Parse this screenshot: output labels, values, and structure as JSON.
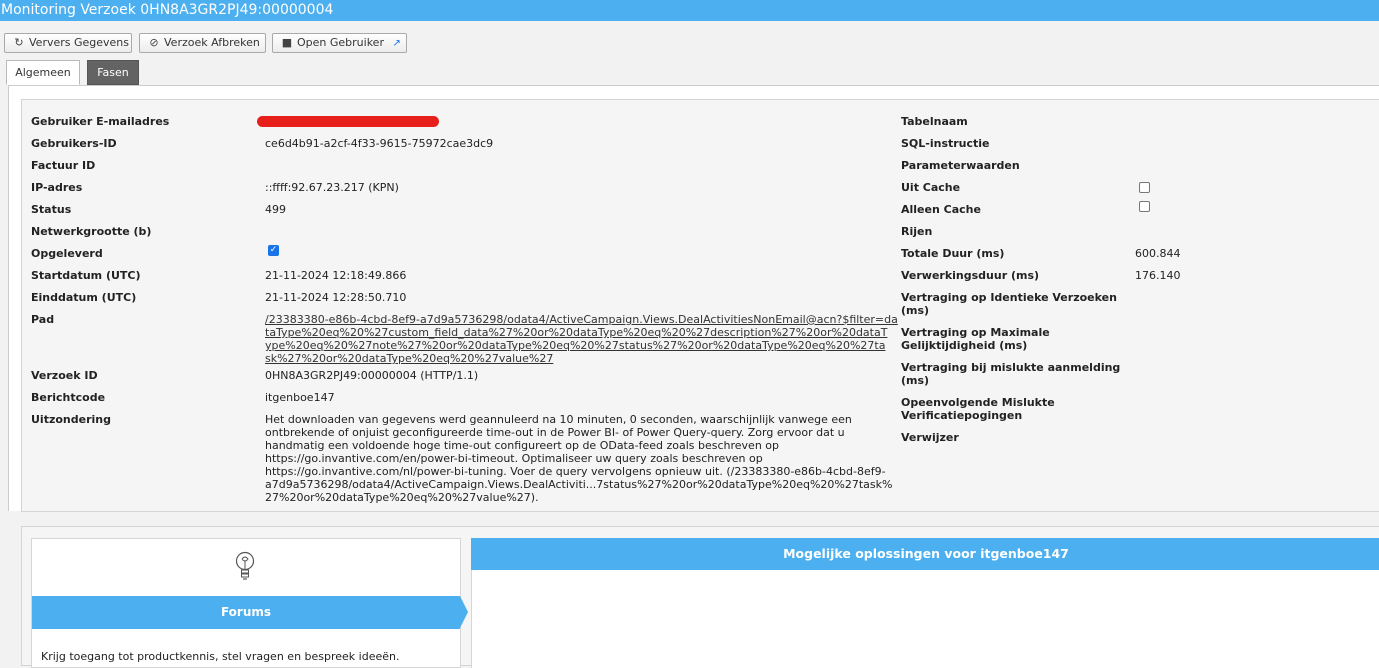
{
  "window": {
    "title": "Monitoring Verzoek 0HN8A3GR2PJ49:00000004"
  },
  "toolbar": {
    "refresh_label": "Ververs Gegevens",
    "abort_label": "Verzoek Afbreken",
    "open_user_label": "Open Gebruiker",
    "refresh_icon": "refresh-icon",
    "abort_icon": "ban-icon",
    "user_icon": "user-icon",
    "external_icon": "external-link-icon"
  },
  "tabs": [
    {
      "label": "Algemeen",
      "active": true
    },
    {
      "label": "Fasen",
      "active": false
    }
  ],
  "left": {
    "email": {
      "label": "Gebruiker E-mailadres",
      "value": ""
    },
    "user_id": {
      "label": "Gebruikers-ID",
      "value": "ce6d4b91-a2cf-4f33-9615-75972cae3dc9"
    },
    "invoice_id": {
      "label": "Factuur ID",
      "value": ""
    },
    "ip": {
      "label": "IP-adres",
      "value": "::ffff:92.67.23.217 (KPN)"
    },
    "status": {
      "label": "Status",
      "value": "499"
    },
    "network_size": {
      "label": "Netwerkgrootte (b)",
      "value": ""
    },
    "delivered": {
      "label": "Opgeleverd",
      "checked": true
    },
    "start": {
      "label": "Startdatum (UTC)",
      "value": "21-11-2024 12:18:49.866"
    },
    "end": {
      "label": "Einddatum (UTC)",
      "value": "21-11-2024 12:28:50.710"
    },
    "path": {
      "label": "Pad",
      "lines": [
        "/23383380-e86b-4cbd-8ef9-a7d9a5736298/odata4/ActiveCampaign.Views.DealActivitiesNonEmail@acn?$filter=da",
        "taType%20eq%20%27custom_field_data%27%20or%20dataType%20eq%20%27description%27%20or%20dataT",
        "ype%20eq%20%27note%27%20or%20dataType%20eq%20%27status%27%20or%20dataType%20eq%20%27ta",
        "sk%27%20or%20dataType%20eq%20%27value%27"
      ]
    },
    "request_id": {
      "label": "Verzoek ID",
      "value": "0HN8A3GR2PJ49:00000004 (HTTP/1.1)"
    },
    "message_code": {
      "label": "Berichtcode",
      "value": "itgenboe147"
    },
    "exception": {
      "label": "Uitzondering",
      "lines": [
        "Het downloaden van gegevens werd geannuleerd na 10 minuten, 0 seconden, waarschijnlijk vanwege een",
        "ontbrekende of onjuist geconfigureerde time-out in de Power BI- of Power Query-query. Zorg ervoor dat u",
        "handmatig een voldoende hoge time-out configureert op de OData-feed zoals beschreven op",
        "https://go.invantive.com/en/power-bi-timeout. Optimaliseer uw query zoals beschreven op",
        "https://go.invantive.com/nl/power-bi-tuning. Voer de query vervolgens opnieuw uit. (/23383380-e86b-4cbd-8ef9-",
        "a7d9a5736298/odata4/ActiveCampaign.Views.DealActiviti...7status%27%20or%20dataType%20eq%20%27task%",
        "27%20or%20dataType%20eq%20%27value%27)."
      ]
    }
  },
  "right": {
    "table_name": {
      "label": "Tabelnaam"
    },
    "sql": {
      "label": "SQL-instructie"
    },
    "params": {
      "label": "Parameterwaarden"
    },
    "from_cache": {
      "label": "Uit Cache",
      "checked": false
    },
    "only_cache": {
      "label": "Alleen Cache",
      "checked": false
    },
    "rows": {
      "label": "Rijen"
    },
    "total_duration": {
      "label": "Totale Duur (ms)",
      "value": "600.844"
    },
    "processing_duration": {
      "label": "Verwerkingsduur (ms)",
      "value": "176.140"
    },
    "delay_identical": {
      "label_1": "Vertraging op Identieke Verzoeken",
      "label_2": "(ms)"
    },
    "delay_max_concurrency": {
      "label_1": "Vertraging op Maximale",
      "label_2": "Gelijktijdigheid (ms)"
    },
    "delay_failed_login": {
      "label_1": "Vertraging bij mislukte aanmelding",
      "label_2": "(ms)"
    },
    "consecutive_failed": {
      "label_1": "Opeenvolgende Mislukte",
      "label_2": "Verificatiepogingen"
    },
    "referrer": {
      "label": "Verwijzer"
    }
  },
  "forums": {
    "icon": "lightbulb-icon",
    "title": "Forums",
    "text": "Krijg toegang tot productkennis, stel vragen en bespreek ideeën."
  },
  "solutions": {
    "title": "Mogelijke oplossingen voor itgenboe147"
  },
  "colors": {
    "accent": "#4baff0",
    "redaction": "#e8201c",
    "tab_inactive": "#636363"
  }
}
